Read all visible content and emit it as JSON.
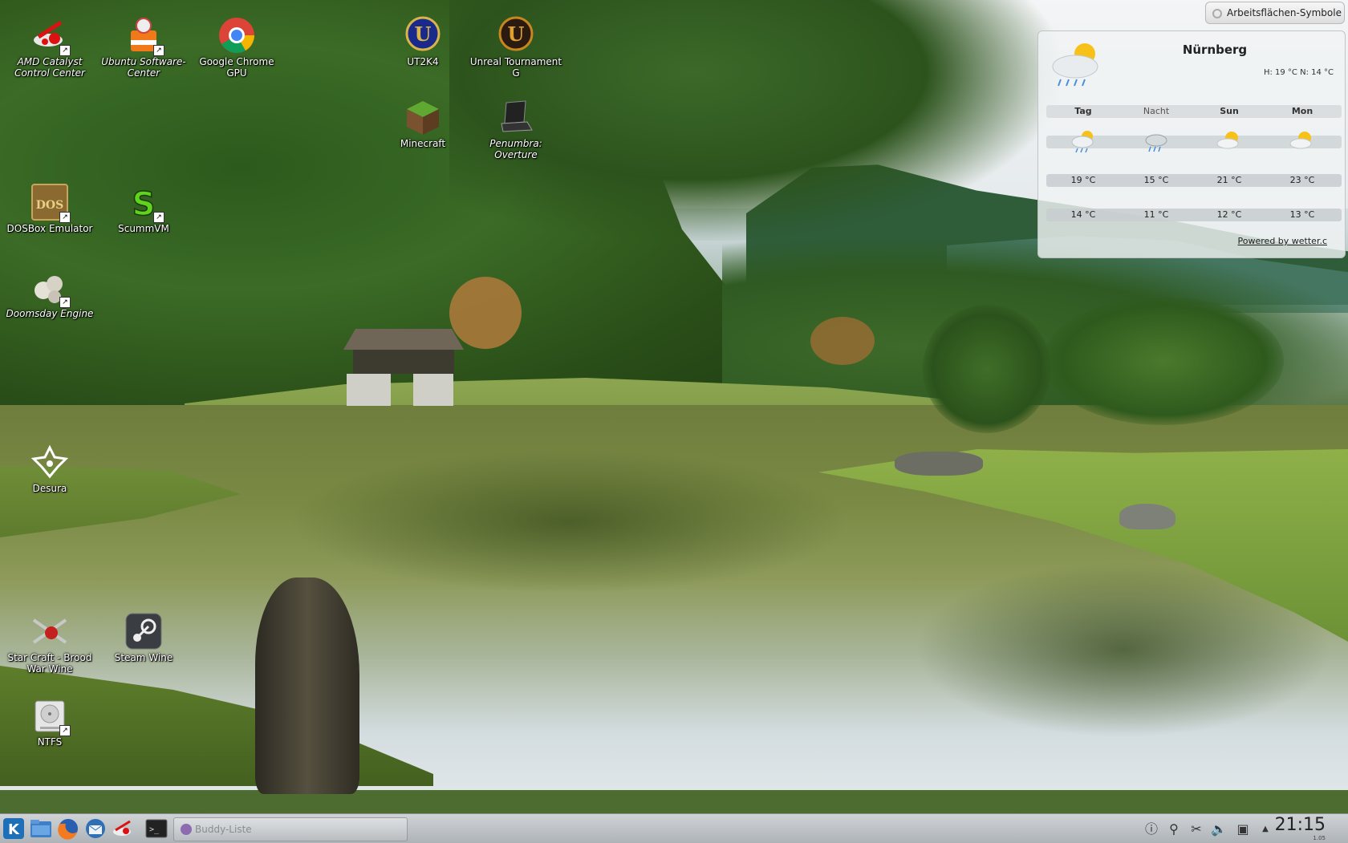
{
  "desktop": {
    "icons": [
      {
        "label": "AMD Catalyst Control Center",
        "icon": "amd-catalyst-icon"
      },
      {
        "label": "Ubuntu Software-Center",
        "icon": "ubuntu-software-center-icon"
      },
      {
        "label": "Google Chrome GPU",
        "icon": "chrome-icon"
      },
      {
        "label": "UT2K4",
        "icon": "unreal-icon"
      },
      {
        "label": "Unreal Tournament G",
        "icon": "unreal-icon"
      },
      {
        "label": "Minecraft",
        "icon": "minecraft-icon"
      },
      {
        "label": "Penumbra: Overture",
        "icon": "penumbra-icon"
      },
      {
        "label": "DOSBox Emulator",
        "icon": "dosbox-icon"
      },
      {
        "label": "ScummVM",
        "icon": "scummvm-icon"
      },
      {
        "label": "Doomsday Engine",
        "icon": "doomsday-icon"
      },
      {
        "label": "Desura",
        "icon": "desura-icon"
      },
      {
        "label": "Star Craft - Brood War Wine",
        "icon": "starcraft-icon"
      },
      {
        "label": "Steam Wine",
        "icon": "steam-icon"
      },
      {
        "label": "NTFS",
        "icon": "hard-drive-icon"
      }
    ]
  },
  "toolbox": {
    "label": "Arbeitsflächen-Symbole"
  },
  "weather": {
    "city": "Nürnberg",
    "hilo": "H: 19 °C N: 14 °C",
    "columns": [
      "Tag",
      "Nacht",
      "Sun",
      "Mon"
    ],
    "icons": [
      "rain-sun-icon",
      "rain-cloud-icon",
      "sun-cloud-icon",
      "sun-cloud-icon"
    ],
    "highs": [
      "19 °C",
      "15 °C",
      "21 °C",
      "23 °C"
    ],
    "lows": [
      "14 °C",
      "11 °C",
      "12 °C",
      "13 °C"
    ],
    "powered_by": "Powered by wetter.c"
  },
  "taskbar": {
    "launchers": [
      "kde-menu-icon",
      "file-manager-icon",
      "firefox-icon",
      "thunderbird-icon",
      "amd-catalyst-icon",
      "terminal-icon"
    ],
    "task_label": "Buddy-Liste",
    "tray": [
      "info-icon",
      "usb-icon",
      "klipper-icon",
      "volume-icon",
      "network-icon",
      "tray-expand-icon"
    ],
    "clock": "21:15",
    "clock_date": "1.05"
  },
  "colors": {
    "panel": "#aeb3b7",
    "accent": "#1d6fb8"
  }
}
